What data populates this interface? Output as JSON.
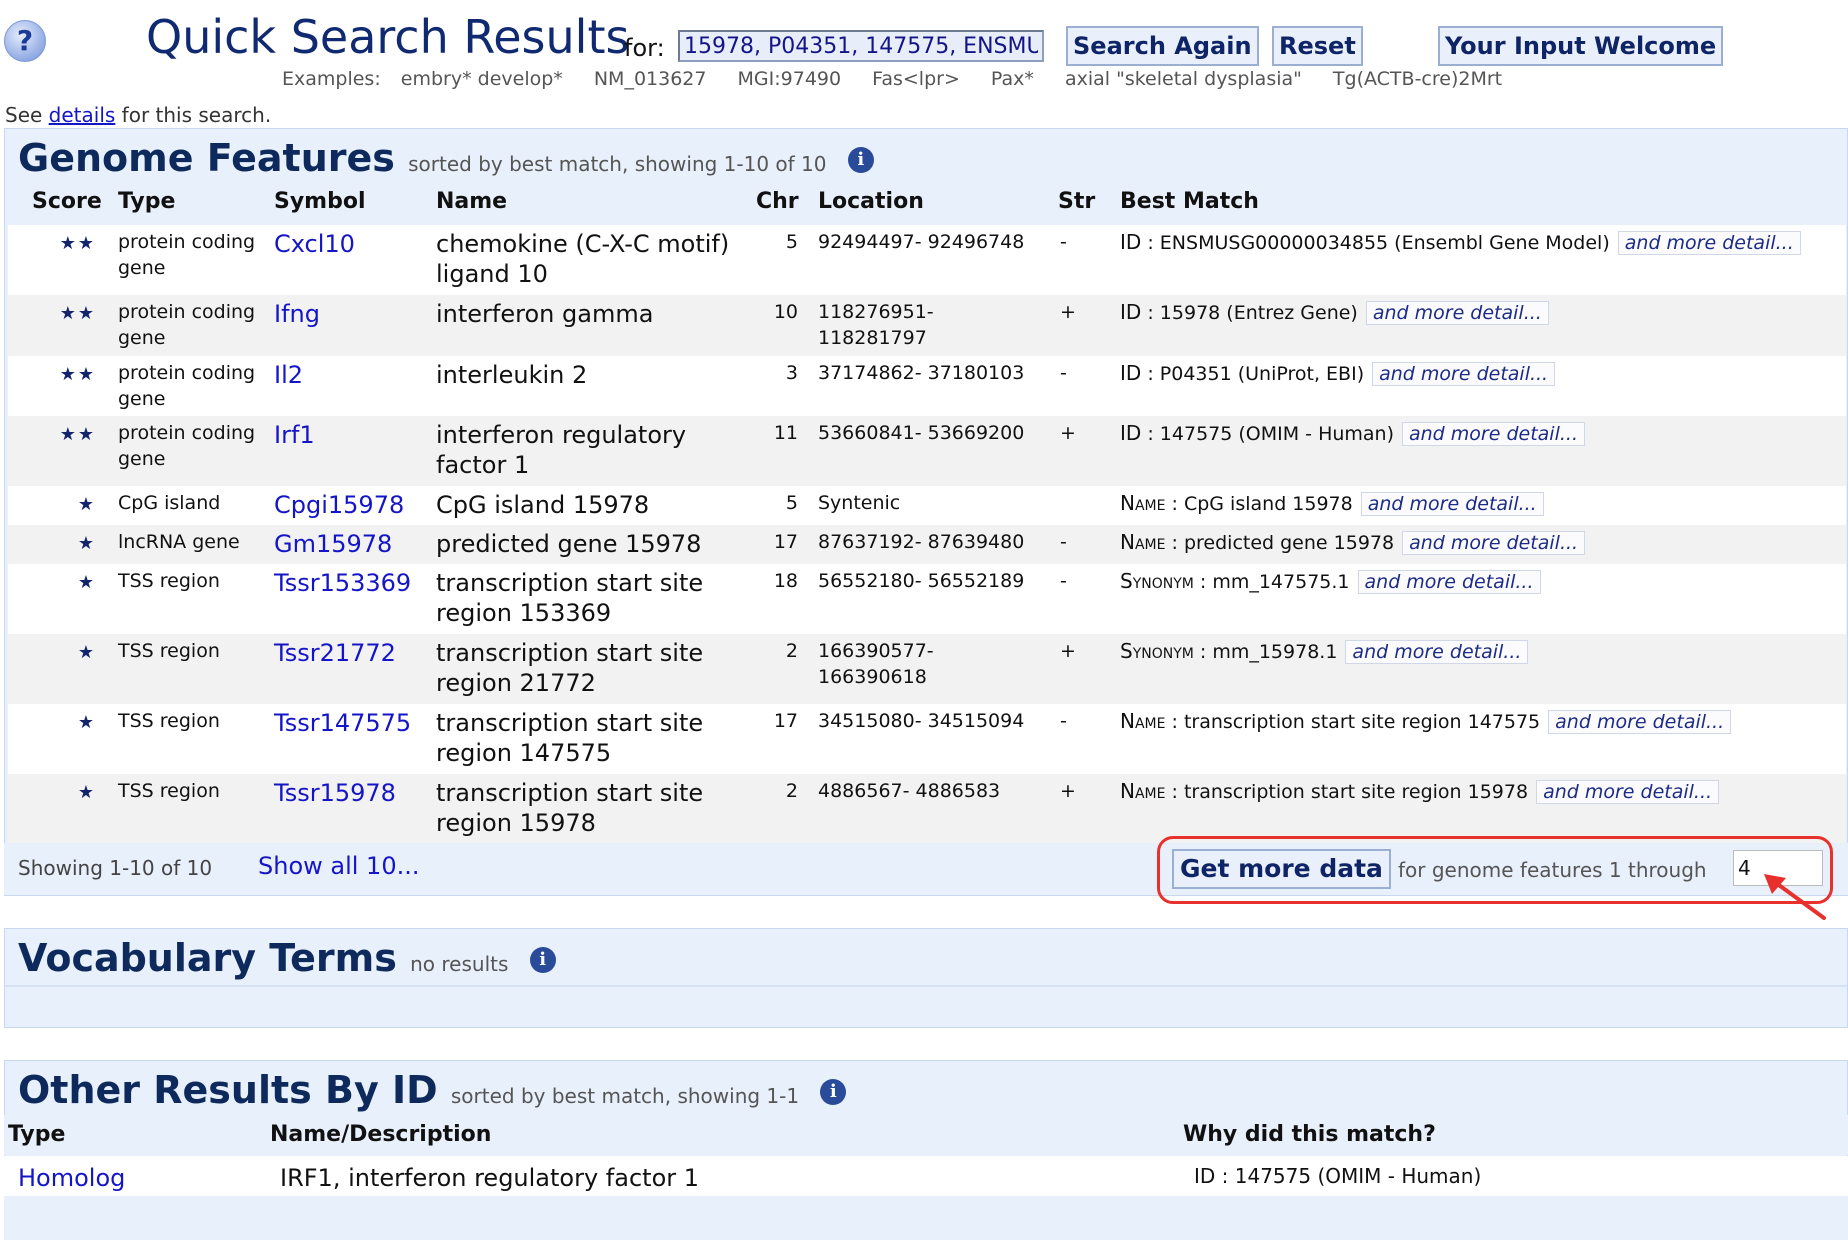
{
  "header": {
    "help_icon_glyph": "?",
    "title": "Quick Search Results",
    "for_label": "for:",
    "query_value": "15978, P04351, 147575, ENSMU",
    "search_again": "Search Again",
    "reset": "Reset",
    "your_input": "Your Input Welcome",
    "examples_label": "Examples:",
    "examples": [
      "embry* develop*",
      "NM_013627",
      "MGI:97490",
      "Fas<lpr>",
      "Pax*",
      "axial \"skeletal dysplasia\"",
      "Tg(ACTB-cre)2Mrt"
    ],
    "see_prefix": "See",
    "details_link": "details",
    "see_suffix": "for this search."
  },
  "genome_features": {
    "title": "Genome Features",
    "subtitle": "sorted by best match, showing 1-10 of 10",
    "info_glyph": "i",
    "columns": {
      "score": "Score",
      "type": "Type",
      "symbol": "Symbol",
      "name": "Name",
      "chr": "Chr",
      "location": "Location",
      "strand": "Str",
      "best_match": "Best Match"
    },
    "rows": [
      {
        "stars": "★★",
        "type": "protein coding gene",
        "symbol": "Cxcl10",
        "name": "chemokine (C-X-C motif) ligand 10",
        "chr": "5",
        "location": "92494497- 92496748",
        "strand": "-",
        "match_label": "ID",
        "match_value": ": ENSMUSG00000034855 (Ensembl Gene Model)",
        "more": "and more detail..."
      },
      {
        "stars": "★★",
        "type": "protein coding gene",
        "symbol": "Ifng",
        "name": "interferon gamma",
        "chr": "10",
        "location": "118276951- 118281797",
        "strand": "+",
        "match_label": "ID",
        "match_value": ": 15978 (Entrez Gene)",
        "more": "and more detail..."
      },
      {
        "stars": "★★",
        "type": "protein coding gene",
        "symbol": "Il2",
        "name": "interleukin 2",
        "chr": "3",
        "location": "37174862- 37180103",
        "strand": "-",
        "match_label": "ID",
        "match_value": ": P04351 (UniProt, EBI)",
        "more": "and more detail..."
      },
      {
        "stars": "★★",
        "type": "protein coding gene",
        "symbol": "Irf1",
        "name": "interferon regulatory factor 1",
        "chr": "11",
        "location": "53660841- 53669200",
        "strand": "+",
        "match_label": "ID",
        "match_value": ": 147575 (OMIM - Human)",
        "more": "and more detail..."
      },
      {
        "stars": "★",
        "type": "CpG island",
        "symbol": "Cpgi15978",
        "name": "CpG island 15978",
        "chr": "5",
        "location": "Syntenic",
        "strand": "",
        "match_label": "Name",
        "match_value": ": CpG island 15978",
        "more": "and more detail..."
      },
      {
        "stars": "★",
        "type": "lncRNA gene",
        "symbol": "Gm15978",
        "name": "predicted gene 15978",
        "chr": "17",
        "location": "87637192- 87639480",
        "strand": "-",
        "match_label": "Name",
        "match_value": ": predicted gene 15978",
        "more": "and more detail..."
      },
      {
        "stars": "★",
        "type": "TSS region",
        "symbol": "Tssr153369",
        "name": "transcription start site region 153369",
        "chr": "18",
        "location": "56552180- 56552189",
        "strand": "-",
        "match_label": "Synonym",
        "match_value": ": mm_147575.1",
        "more": "and more detail..."
      },
      {
        "stars": "★",
        "type": "TSS region",
        "symbol": "Tssr21772",
        "name": "transcription start site region 21772",
        "chr": "2",
        "location": "166390577- 166390618",
        "strand": "+",
        "match_label": "Synonym",
        "match_value": ": mm_15978.1",
        "more": "and more detail..."
      },
      {
        "stars": "★",
        "type": "TSS region",
        "symbol": "Tssr147575",
        "name": "transcription start site region 147575",
        "chr": "17",
        "location": "34515080- 34515094",
        "strand": "-",
        "match_label": "Name",
        "match_value": ": transcription start site region 147575",
        "more": "and more detail..."
      },
      {
        "stars": "★",
        "type": "TSS region",
        "symbol": "Tssr15978",
        "name": "transcription start site region 15978",
        "chr": "2",
        "location": "4886567- 4886583",
        "strand": "+",
        "match_label": "Name",
        "match_value": ": transcription start site region 15978",
        "more": "and more detail..."
      }
    ],
    "footer": {
      "showing": "Showing 1-10 of 10",
      "show_all": "Show all 10...",
      "get_more": "Get more data",
      "for_genome": "for genome features 1 through",
      "through_value": "4"
    }
  },
  "vocabulary": {
    "title": "Vocabulary Terms",
    "subtitle": "no results",
    "info_glyph": "i"
  },
  "other_results": {
    "title": "Other Results By ID",
    "subtitle": "sorted by best match, showing 1-1",
    "info_glyph": "i",
    "columns": {
      "type": "Type",
      "name": "Name/Description",
      "why": "Why did this match?"
    },
    "rows": [
      {
        "type": "Homolog",
        "name": "IRF1, interferon regulatory factor 1",
        "why": "ID : 147575 (OMIM - Human)"
      }
    ]
  },
  "colors": {
    "link": "#1515c8",
    "title": "#102a72",
    "panel_bg": "#e8f0fb",
    "highlight": "#e8302c"
  }
}
